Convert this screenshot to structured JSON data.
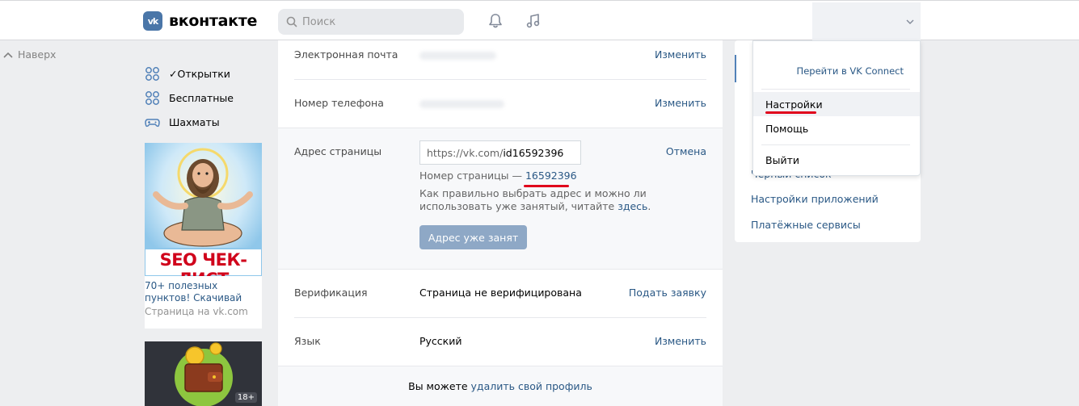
{
  "header": {
    "logo_text": "вконтакте",
    "logo_mark": "vk",
    "search_placeholder": "Поиск"
  },
  "left": {
    "up_label": "Наверх",
    "menu": [
      {
        "label": "✓Открытки",
        "icon": "apps-grid-icon"
      },
      {
        "label": "Бесплатные",
        "icon": "apps-grid-icon"
      },
      {
        "label": "Шахматы",
        "icon": "gamepad-icon"
      }
    ],
    "ad": {
      "banner_text": "SEO ЧЕК-ЛИСТ",
      "title": "70+ полезных пунктов! Скачивай",
      "subtitle": "Страница на vk.com"
    },
    "ad2_badge": "18+"
  },
  "settings": {
    "email": {
      "label": "Электронная почта",
      "action": "Изменить"
    },
    "phone": {
      "label": "Номер телефона",
      "action": "Изменить"
    },
    "address": {
      "label": "Адрес страницы",
      "prefix": "https://vk.com/",
      "value": "id16592396",
      "cancel": "Отмена",
      "page_num_label": "Номер страницы —",
      "page_num": "16592396",
      "hint_line1": "Как правильно выбрать адрес и можно ли",
      "hint_line2_pre": "использовать уже занятый, читайте ",
      "hint_link": "здесь",
      "hint_end": ".",
      "button": "Адрес уже занят"
    },
    "verification": {
      "label": "Верификация",
      "value": "Страница не верифицирована",
      "action": "Подать заявку"
    },
    "language": {
      "label": "Язык",
      "value": "Русский",
      "action": "Изменить"
    },
    "footer_pre": "Вы можете ",
    "footer_link": "удалить свой профиль"
  },
  "right_menu": {
    "items": [
      "Чёрный список",
      "Настройки приложений",
      "Платёжные сервисы"
    ]
  },
  "dropdown": {
    "connect": "Перейти в VK Connect",
    "settings": "Настройки",
    "help": "Помощь",
    "logout": "Выйти"
  },
  "colors": {
    "accent": "#2a5885",
    "brand": "#4a76a8",
    "highlight": "#e0001b"
  }
}
